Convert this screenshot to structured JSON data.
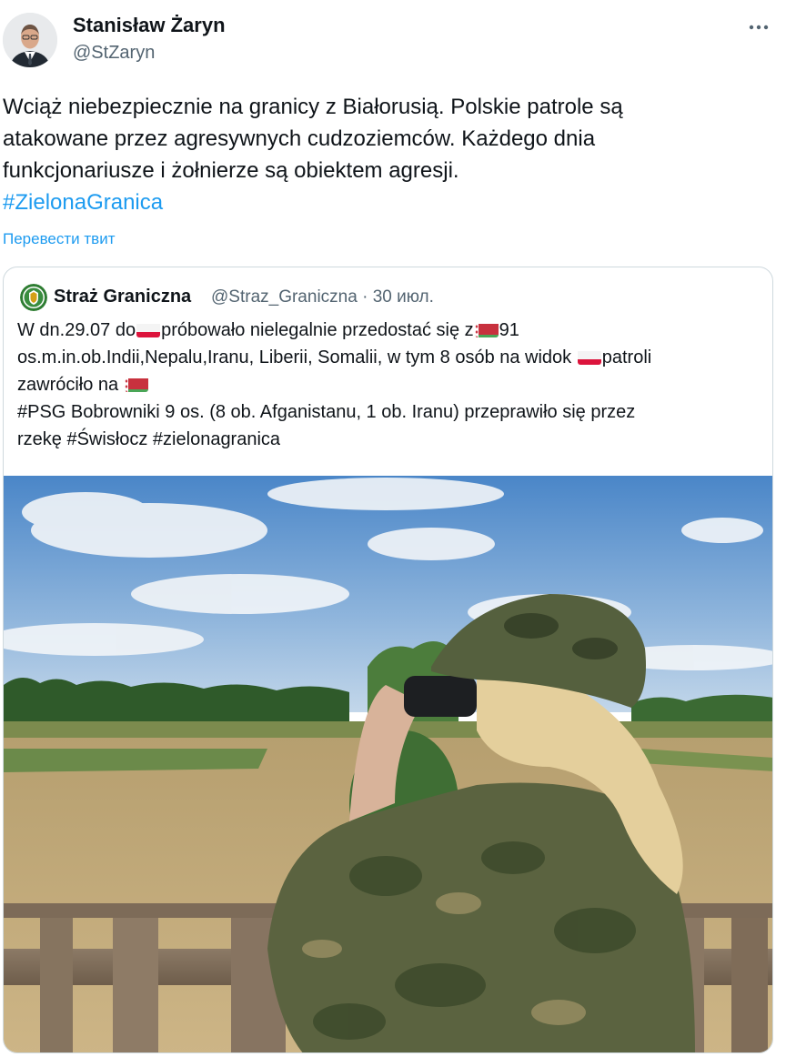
{
  "author": {
    "name": "Stanisław Żaryn",
    "handle": "@StZaryn"
  },
  "tweet": {
    "lines": [
      "Wciąż niebezpiecznie na granicy z Białorusią. Polskie patrole są",
      "atakowane przez agresywnych cudzoziemców. Każdego dnia",
      "funkcjonariusze i żołnierze są obiektem agresji."
    ],
    "hashtag": "#ZielonaGranica",
    "translate_label": "Перевести твит"
  },
  "quoted": {
    "name": "Straż Graniczna",
    "handle": "@Straz_Graniczna",
    "separator": "·",
    "date": "30 июл.",
    "line1_a": "W dn.29.07 do",
    "line1_b": "próbowało nielegalnie przedostać się z",
    "line1_c": "91",
    "line2_a": "os.m.in.ob.Indii,Nepalu,Iranu, Liberii, Somalii, w tym 8 osób na widok ",
    "line2_b": "patroli",
    "line3_a": "zawróciło na ",
    "line4": "#PSG Bobrowniki 9 os. (8 ob. Afganistanu, 1 ob. Iranu) przeprawiło się przez",
    "line5": "rzekę #Świsłocz #zielonagranica"
  },
  "icons": {
    "more": "more-horizontal-icon",
    "flag_pl": "poland-flag-icon",
    "flag_by": "belarus-flag-icon"
  },
  "colors": {
    "link": "#1d9bf0",
    "secondary_text": "#536471",
    "border": "#cfd9de"
  }
}
